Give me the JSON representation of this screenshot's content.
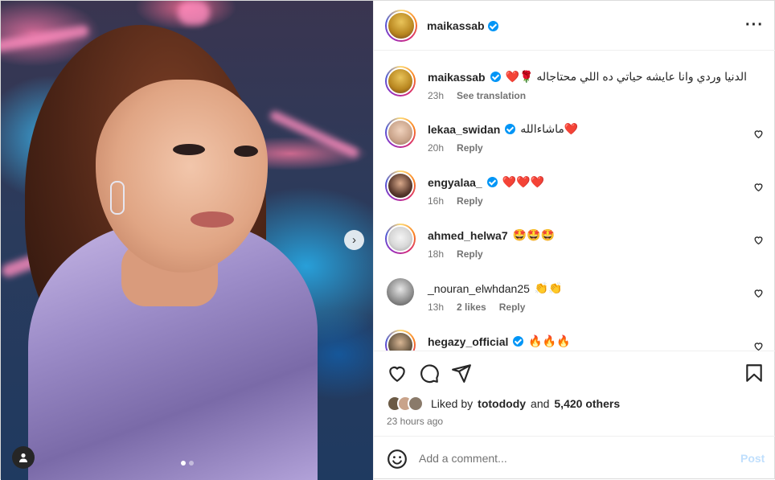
{
  "post": {
    "author": "maikassab",
    "caption": "الدنيا وردي وانا عايشه حياتي ده اللي محتاجاله 🌹❤️",
    "caption_time": "23h",
    "see_translation": "See translation",
    "more_icon": "more-horizontal-icon",
    "next_icon": "chevron-right-icon",
    "tag_icon": "user-tag-icon",
    "media_index": 1,
    "media_count": 2
  },
  "comments": [
    {
      "username": "lekaa_swidan",
      "verified": true,
      "text": "ماشاءالله❤️",
      "time": "20h",
      "likes": "",
      "reply": "Reply",
      "avatar_color": "#c9a38a"
    },
    {
      "username": "engyalaa_",
      "verified": true,
      "text": "❤️❤️❤️",
      "time": "16h",
      "likes": "",
      "reply": "Reply",
      "avatar_color": "#3b2a26"
    },
    {
      "username": "ahmed_helwa7",
      "verified": false,
      "text": "🤩🤩🤩",
      "time": "18h",
      "likes": "",
      "reply": "Reply",
      "avatar_color": "#e9e9e9"
    },
    {
      "username": "_nouran_elwhdan25",
      "verified": false,
      "text": "👏👏",
      "time": "13h",
      "likes": "2 likes",
      "reply": "Reply",
      "avatar_color": "#8a8a8a"
    },
    {
      "username": "hegazy_official",
      "verified": true,
      "text": "🔥🔥🔥",
      "time": "",
      "likes": "",
      "reply": "",
      "avatar_color": "#6b5a45"
    }
  ],
  "actions": {
    "like_icon": "heart-icon",
    "comment_icon": "comment-icon",
    "share_icon": "send-icon",
    "save_icon": "bookmark-icon",
    "liked_by_prefix": "Liked by",
    "liked_by_user": "totodody",
    "liked_by_and": "and",
    "liked_by_others": "5,420 others",
    "time_ago": "23 hours ago"
  },
  "add_comment": {
    "placeholder": "Add a comment...",
    "post_label": "Post",
    "emoji_icon": "emoji-icon"
  },
  "colors": {
    "verified": "#0095f6",
    "post_disabled": "#c0dffd",
    "heart_red": "#ed4956"
  }
}
